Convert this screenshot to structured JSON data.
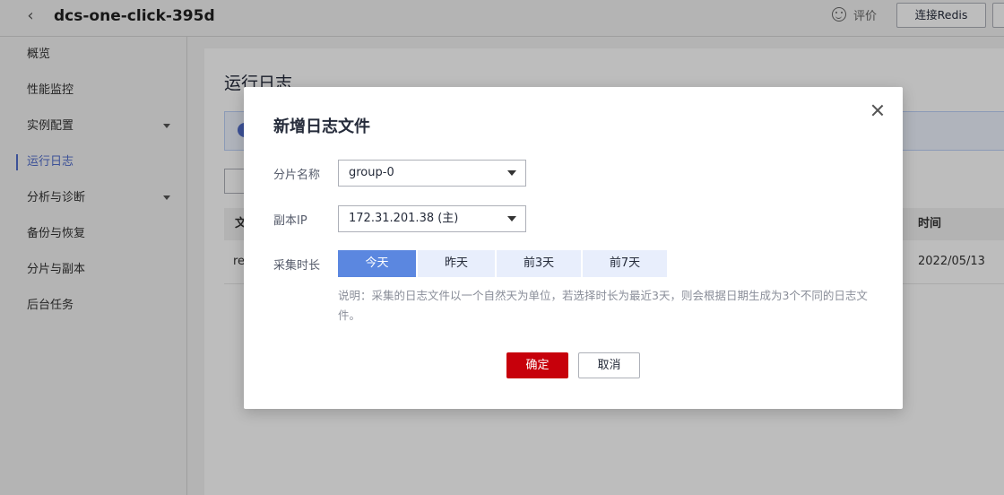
{
  "header": {
    "back_icon": "chevron-left-icon",
    "title": "dcs-one-click-395d",
    "rate_icon": "smile-icon",
    "rate_label": "评价",
    "connect_label": "连接Redis"
  },
  "sidebar": {
    "items": [
      {
        "label": "概览"
      },
      {
        "label": "性能监控"
      },
      {
        "label": "实例配置"
      },
      {
        "label": "运行日志"
      },
      {
        "label": "分析与诊断"
      },
      {
        "label": "备份与恢复"
      },
      {
        "label": "分片与副本"
      },
      {
        "label": "后台任务"
      }
    ],
    "active": "运行日志"
  },
  "main": {
    "title": "运行日志",
    "table": {
      "headers": [
        "文",
        "时间"
      ],
      "rows": [
        {
          "c1": "re",
          "time": "2022/05/13"
        }
      ]
    }
  },
  "dialog": {
    "title": "新增日志文件",
    "shard": {
      "label": "分片名称",
      "value": "group-0"
    },
    "replica": {
      "label": "副本IP",
      "value": "172.31.201.38 (主)"
    },
    "duration": {
      "label": "采集时长",
      "options": [
        "今天",
        "昨天",
        "前3天",
        "前7天"
      ],
      "selected": "今天"
    },
    "hint": "说明：采集的日志文件以一个自然天为单位，若选择时长为最近3天，则会根据日期生成为3个不同的日志文件。",
    "ok_label": "确定",
    "cancel_label": "取消"
  },
  "colors": {
    "primary": "#5b87e0",
    "danger": "#c7000b",
    "nav_active": "#526ecc"
  }
}
